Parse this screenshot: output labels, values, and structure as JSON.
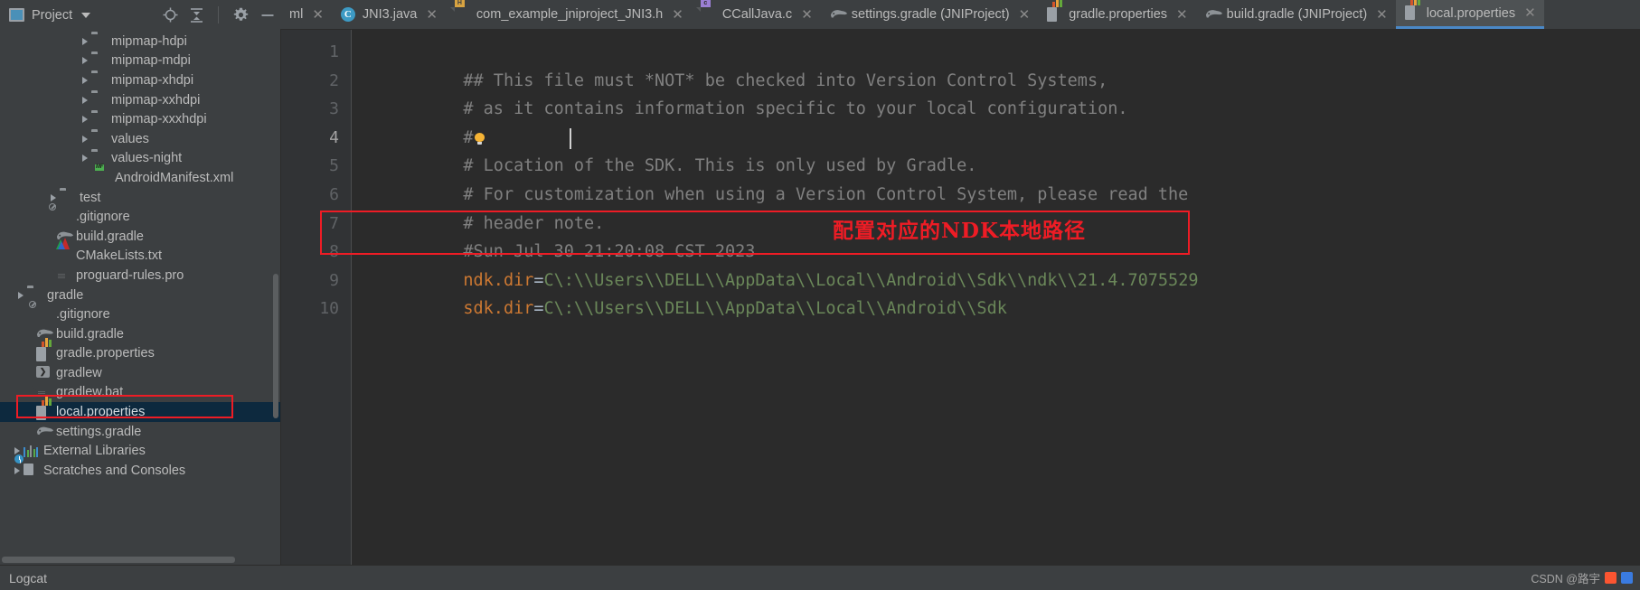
{
  "toolwindow": {
    "title": "Project",
    "dropdown_icon": "chevron-down-icon",
    "icons": [
      "locate-icon",
      "collapse-all-icon",
      "settings-gear-icon",
      "hide-icon"
    ]
  },
  "tabs": [
    {
      "label": "ml",
      "icon": "xml-file-icon",
      "active": false,
      "truncated": true
    },
    {
      "label": "JNI3.java",
      "icon": "java-class-icon",
      "active": false
    },
    {
      "label": "com_example_jniproject_JNI3.h",
      "icon": "header-file-icon",
      "active": false
    },
    {
      "label": "CCallJava.c",
      "icon": "c-file-icon",
      "active": false
    },
    {
      "label": "settings.gradle (JNIProject)",
      "icon": "gradle-file-icon",
      "active": false
    },
    {
      "label": "gradle.properties",
      "icon": "properties-file-icon",
      "active": false
    },
    {
      "label": "build.gradle (JNIProject)",
      "icon": "gradle-file-icon",
      "active": false
    },
    {
      "label": "local.properties",
      "icon": "properties-file-icon",
      "active": true
    }
  ],
  "tab_close_glyph": "✕",
  "sidebar": {
    "rows": [
      {
        "label": "mipmap-hdpi",
        "indent": 88,
        "arrow": true,
        "icon": "folder-icon"
      },
      {
        "label": "mipmap-mdpi",
        "indent": 88,
        "arrow": true,
        "icon": "folder-icon"
      },
      {
        "label": "mipmap-xhdpi",
        "indent": 88,
        "arrow": true,
        "icon": "folder-icon"
      },
      {
        "label": "mipmap-xxhdpi",
        "indent": 88,
        "arrow": true,
        "icon": "folder-icon"
      },
      {
        "label": "mipmap-xxxhdpi",
        "indent": 88,
        "arrow": true,
        "icon": "folder-icon"
      },
      {
        "label": "values",
        "indent": 88,
        "arrow": true,
        "icon": "folder-icon"
      },
      {
        "label": "values-night",
        "indent": 88,
        "arrow": true,
        "icon": "folder-icon"
      },
      {
        "label": "AndroidManifest.xml",
        "indent": 105,
        "arrow": false,
        "icon": "manifest-file-icon"
      },
      {
        "label": "test",
        "indent": 53,
        "arrow": true,
        "icon": "folder-icon"
      },
      {
        "label": ".gitignore",
        "indent": 62,
        "arrow": false,
        "icon": "gitignore-file-icon"
      },
      {
        "label": "build.gradle",
        "indent": 62,
        "arrow": false,
        "icon": "gradle-file-icon"
      },
      {
        "label": "CMakeLists.txt",
        "indent": 62,
        "arrow": false,
        "icon": "cmake-file-icon"
      },
      {
        "label": "proguard-rules.pro",
        "indent": 62,
        "arrow": false,
        "icon": "text-file-icon"
      },
      {
        "label": "gradle",
        "indent": 17,
        "arrow": true,
        "icon": "folder-icon"
      },
      {
        "label": ".gitignore",
        "indent": 40,
        "arrow": false,
        "icon": "gitignore-file-icon"
      },
      {
        "label": "build.gradle",
        "indent": 40,
        "arrow": false,
        "icon": "gradle-file-icon"
      },
      {
        "label": "gradle.properties",
        "indent": 40,
        "arrow": false,
        "icon": "properties-file-icon"
      },
      {
        "label": "gradlew",
        "indent": 40,
        "arrow": false,
        "icon": "script-file-icon"
      },
      {
        "label": "gradlew.bat",
        "indent": 40,
        "arrow": false,
        "icon": "text-file-icon"
      },
      {
        "label": "local.properties",
        "indent": 40,
        "arrow": false,
        "icon": "properties-file-icon",
        "selected": true
      },
      {
        "label": "settings.gradle",
        "indent": 40,
        "arrow": false,
        "icon": "gradle-file-icon"
      },
      {
        "label": "External Libraries",
        "indent": 13,
        "arrow": true,
        "icon": "libraries-icon"
      },
      {
        "label": "Scratches and Consoles",
        "indent": 13,
        "arrow": true,
        "icon": "scratches-icon"
      }
    ]
  },
  "editor": {
    "line_numbers": [
      "1",
      "2",
      "3",
      "4",
      "5",
      "6",
      "7",
      "8",
      "9",
      "10"
    ],
    "current_line": "4",
    "lines": [
      {
        "n": "1",
        "type": "comment",
        "text": "## This file must *NOT* be checked into Version Control Systems,"
      },
      {
        "n": "2",
        "type": "comment",
        "text": "# as it contains information specific to your local configuration."
      },
      {
        "n": "3",
        "type": "comment",
        "text": "#",
        "bulb": true
      },
      {
        "n": "4",
        "type": "comment",
        "text": "# Location of the SDK. This is only used by Gradle."
      },
      {
        "n": "5",
        "type": "comment",
        "text": "# For customization when using a Version Control System, please read the"
      },
      {
        "n": "6",
        "type": "comment",
        "text": "# header note."
      },
      {
        "n": "7",
        "type": "comment",
        "text": "#Sun Jul 30 21:20:08 CST 2023"
      },
      {
        "n": "8",
        "type": "property",
        "key": "ndk.dir",
        "eq": "=",
        "value": "C\\:\\\\Users\\\\DELL\\\\AppData\\\\Local\\\\Android\\\\Sdk\\\\ndk\\\\21.4.7075529"
      },
      {
        "n": "9",
        "type": "property",
        "key": "sdk.dir",
        "eq": "=",
        "value": "C\\:\\\\Users\\\\DELL\\\\AppData\\\\Local\\\\Android\\\\Sdk"
      },
      {
        "n": "10",
        "type": "blank",
        "text": ""
      }
    ],
    "annotation": "配置对应的NDK本地路径"
  },
  "statusbar": {
    "left_label": "Logcat",
    "watermark": "CSDN @路宇"
  },
  "colors": {
    "accent": "#4a88c7",
    "highlight_red": "#ee1c25",
    "selection": "#0d293e",
    "editor_bg": "#2b2b2b",
    "panel_bg": "#3c3f41",
    "comment": "#808080",
    "key": "#cc7832",
    "value": "#6a8759",
    "escape": "#6897bb"
  }
}
